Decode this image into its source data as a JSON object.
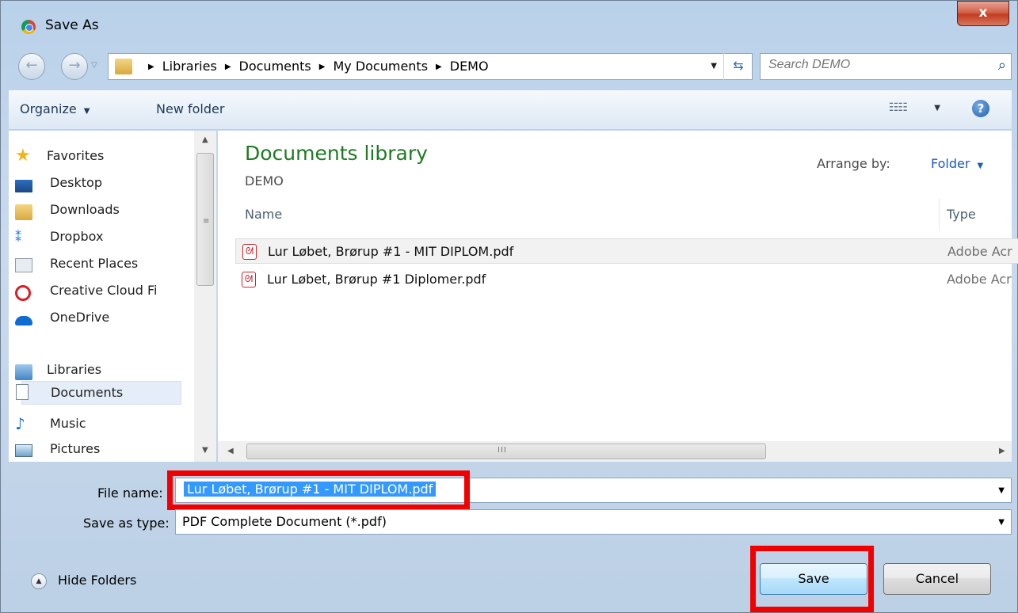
{
  "window": {
    "title": "Save As",
    "close_label": "x"
  },
  "address": {
    "crumbs": [
      "Libraries",
      "Documents",
      "My Documents",
      "DEMO"
    ]
  },
  "search": {
    "placeholder": "Search DEMO"
  },
  "toolbar": {
    "organize_label": "Organize",
    "new_folder_label": "New folder",
    "help_label": "?"
  },
  "sidebar": {
    "favorites_label": "Favorites",
    "favorites": [
      "Desktop",
      "Downloads",
      "Dropbox",
      "Recent Places",
      "Creative Cloud Fi",
      "OneDrive"
    ],
    "libraries_label": "Libraries",
    "libraries": [
      "Documents",
      "Music",
      "Pictures"
    ],
    "selected": "Documents"
  },
  "content": {
    "library_title": "Documents library",
    "library_subtitle": "DEMO",
    "arrange_label": "Arrange by:",
    "arrange_value": "Folder",
    "columns": {
      "name": "Name",
      "type": "Type"
    },
    "files": [
      {
        "name": "Lur Løbet, Brørup #1 - MIT DIPLOM.pdf",
        "type": "Adobe Acr"
      },
      {
        "name": "Lur Løbet, Brørup #1 Diplomer.pdf",
        "type": "Adobe Acr"
      }
    ]
  },
  "form": {
    "filename_label": "File name:",
    "filename_value": "Lur Løbet, Brørup #1 - MIT DIPLOM.pdf",
    "savetype_label": "Save as type:",
    "savetype_value": "PDF Complete Document (*.pdf)"
  },
  "footer": {
    "hide_folders_label": "Hide Folders",
    "save_label": "Save",
    "cancel_label": "Cancel"
  },
  "colors": {
    "highlight": "#f20000",
    "selection": "#3399ff",
    "library_title": "#1e7a23"
  }
}
